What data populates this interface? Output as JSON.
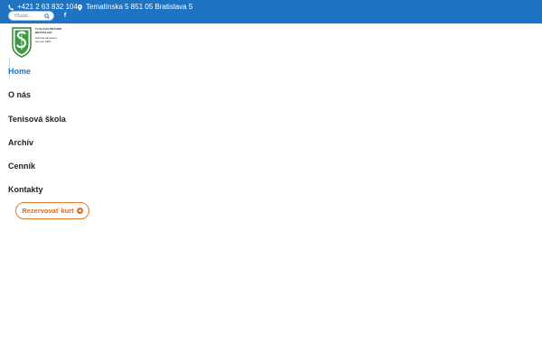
{
  "topbar": {
    "phone": "+421 2 63 832 104",
    "address": "Tematínska 5 851 05 Bratislava 5",
    "phone_icon": "phone-icon",
    "address_icon": "map-pin-icon",
    "facebook_glyph": "f",
    "background_color": "#1e74c3"
  },
  "search": {
    "placeholder": "Hľadať..."
  },
  "logo": {
    "line1": "TJ SLÁVIA PRÁVNIK",
    "line2": "BRATISLAVA",
    "line3": "História úspechov",
    "line4": "od roku 1984"
  },
  "menu": {
    "items": [
      {
        "label": "Home",
        "active": true
      },
      {
        "label": "O nás",
        "active": false
      },
      {
        "label": "Tenisová škola",
        "active": false
      },
      {
        "label": "Archív",
        "active": false
      },
      {
        "label": "Cenník",
        "active": false
      },
      {
        "label": "Kontakty",
        "active": false
      }
    ],
    "active_color": "#1e74c3"
  },
  "cta": {
    "label": "Rezervovať kurt",
    "color": "#e07b2c"
  }
}
